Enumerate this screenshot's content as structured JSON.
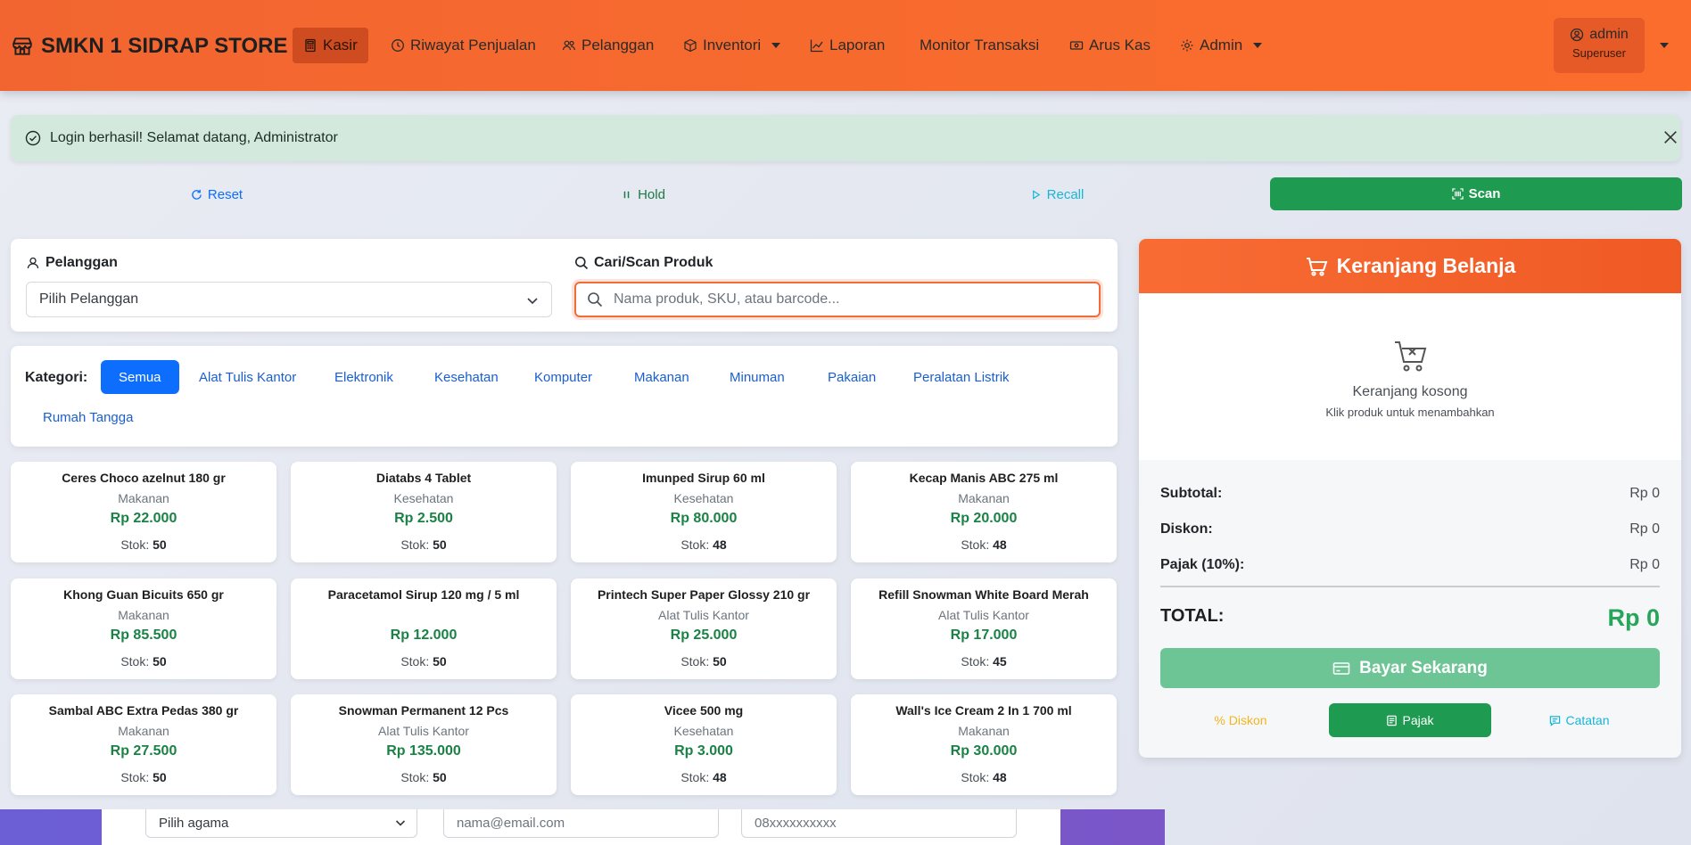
{
  "brand": {
    "name": "SMKN 1 SIDRAP STORE"
  },
  "nav": {
    "kasir": "Kasir",
    "riwayat": "Riwayat Penjualan",
    "pelanggan": "Pelanggan",
    "inventori": "Inventori",
    "laporan": "Laporan",
    "monitor": "Monitor Transaksi",
    "arus_kas": "Arus Kas",
    "admin": "Admin"
  },
  "user": {
    "name": "admin",
    "role": "Superuser"
  },
  "alert": {
    "message": "Login berhasil! Selamat datang, Administrator"
  },
  "actions": {
    "reset": "Reset",
    "hold": "Hold",
    "recall": "Recall",
    "scan": "Scan"
  },
  "customer": {
    "label": "Pelanggan",
    "selected": "Pilih Pelanggan"
  },
  "search": {
    "label": "Cari/Scan Produk",
    "placeholder": "Nama produk, SKU, atau barcode..."
  },
  "categories": {
    "label": "Kategori:",
    "items": [
      "Semua",
      "Alat Tulis Kantor",
      "Elektronik",
      "Kesehatan",
      "Komputer",
      "Makanan",
      "Minuman",
      "Pakaian",
      "Peralatan Listrik",
      "Rumah Tangga"
    ]
  },
  "stock_label": "Stok:",
  "products": [
    {
      "name": "Ceres Choco azelnut 180 gr",
      "category": "Makanan",
      "price": "Rp 22.000",
      "stock": "50"
    },
    {
      "name": "Diatabs 4 Tablet",
      "category": "Kesehatan",
      "price": "Rp 2.500",
      "stock": "50"
    },
    {
      "name": "Imunped Sirup 60 ml",
      "category": "Kesehatan",
      "price": "Rp 80.000",
      "stock": "48"
    },
    {
      "name": "Kecap Manis ABC 275 ml",
      "category": "Makanan",
      "price": "Rp 20.000",
      "stock": "48"
    },
    {
      "name": "Khong Guan Bicuits 650 gr",
      "category": "Makanan",
      "price": "Rp 85.500",
      "stock": "50"
    },
    {
      "name": "Paracetamol Sirup 120 mg / 5 ml",
      "category": "",
      "price": "Rp 12.000",
      "stock": "50"
    },
    {
      "name": "Printech Super Paper Glossy 210 gr",
      "category": "Alat Tulis Kantor",
      "price": "Rp 25.000",
      "stock": "50"
    },
    {
      "name": "Refill Snowman White Board Merah",
      "category": "Alat Tulis Kantor",
      "price": "Rp 17.000",
      "stock": "45"
    },
    {
      "name": "Sambal ABC Extra Pedas 380 gr",
      "category": "Makanan",
      "price": "Rp 27.500",
      "stock": "50"
    },
    {
      "name": "Snowman Permanent 12 Pcs",
      "category": "Alat Tulis Kantor",
      "price": "Rp 135.000",
      "stock": "50"
    },
    {
      "name": "Vicee 500 mg",
      "category": "Kesehatan",
      "price": "Rp 3.000",
      "stock": "48"
    },
    {
      "name": "Wall's Ice Cream 2 In 1 700 ml",
      "category": "Makanan",
      "price": "Rp 30.000",
      "stock": "48"
    }
  ],
  "cart": {
    "title": "Keranjang Belanja",
    "empty": "Keranjang kosong",
    "hint": "Klik produk untuk menambahkan",
    "subtotal_label": "Subtotal:",
    "subtotal": "Rp 0",
    "diskon_label": "Diskon:",
    "diskon": "Rp 0",
    "pajak_label": "Pajak (10%):",
    "pajak": "Rp 0",
    "total_label": "TOTAL:",
    "total": "Rp 0",
    "pay": "Bayar Sekarang",
    "btn_diskon": "% Diskon",
    "btn_pajak": "Pajak",
    "btn_catatan": "Catatan"
  },
  "bottom_form": {
    "agama": "Pilih agama",
    "email_placeholder": "nama@email.com",
    "phone_placeholder": "08xxxxxxxxxx"
  },
  "colors": {
    "primary": "#f86b2e",
    "success": "#1e9b50",
    "accent_blue": "#0d6efd"
  }
}
